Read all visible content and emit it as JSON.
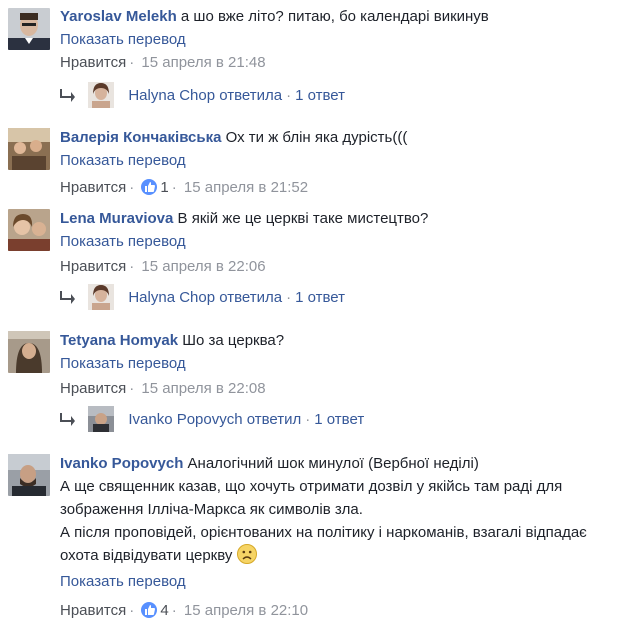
{
  "comments": [
    {
      "author": "Yaroslav Melekh",
      "text_lines": [
        "а шо вже літо? питаю, бо календарі викинув"
      ],
      "translate": "Показать перевод",
      "like_label": "Нравится",
      "like_count": "",
      "timestamp": "15 апреля в 21:48",
      "reply": {
        "name": "Halyna Chop ответила",
        "count": "1 ответ"
      }
    },
    {
      "author": "Валерія Кончаківська",
      "text_lines": [
        "Ох ти ж блін яка дурість((("
      ],
      "translate": "Показать перевод",
      "like_label": "Нравится",
      "like_count": "1",
      "timestamp": "15 апреля в 21:52"
    },
    {
      "author": "Lena Muraviova",
      "text_lines": [
        "В якій же це церкві таке мистецтво?"
      ],
      "translate": "Показать перевод",
      "like_label": "Нравится",
      "like_count": "",
      "timestamp": "15 апреля в 22:06",
      "reply": {
        "name": "Halyna Chop ответила",
        "count": "1 ответ"
      }
    },
    {
      "author": "Tetyana Homyak",
      "text_lines": [
        "Шо за церква?"
      ],
      "translate": "Показать перевод",
      "like_label": "Нравится",
      "like_count": "",
      "timestamp": "15 апреля в 22:08",
      "reply": {
        "name": "Ivanko Popovych ответил",
        "count": "1 ответ"
      }
    },
    {
      "author": "Ivanko Popovych",
      "text_lines": [
        "Аналогічний шок минулої (Вербної неділі)",
        "А ще священник казав, що хочуть отримати дозвіл у якійсь там раді для",
        "зображення Ілліча-Маркса як символів зла.",
        "А після проповідей, орієнтованих на політику і наркоманів, взагалі відпадає",
        "охота відвідувати церкву"
      ],
      "translate": "Показать перевод",
      "like_label": "Нравится",
      "like_count": "4",
      "timestamp": "15 апреля в 22:10"
    }
  ],
  "colors": {
    "link": "#365899",
    "meta": "#90949c",
    "text": "#1d2129",
    "like_blue": "#5890ff"
  },
  "icons": {
    "reply": "reply-arrow-icon",
    "like": "thumbs-up-icon",
    "emoji": "sad-face-icon"
  }
}
